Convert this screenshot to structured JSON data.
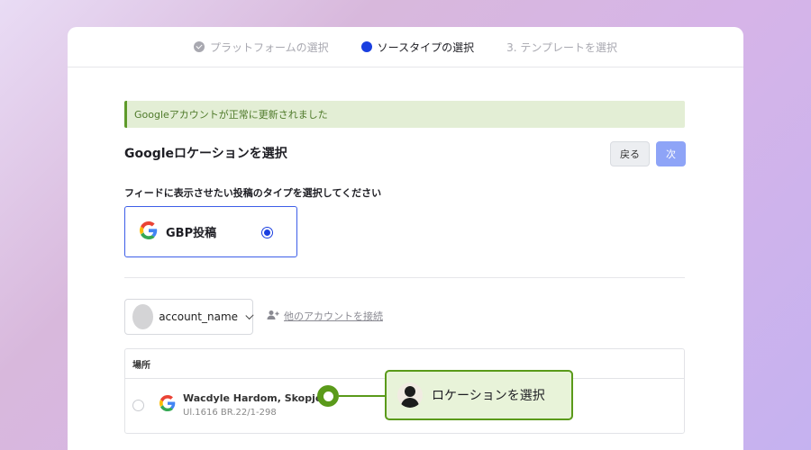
{
  "steps": [
    {
      "label": "プラットフォームの選択",
      "state": "done"
    },
    {
      "label": "ソースタイプの選択",
      "state": "current"
    },
    {
      "label": "3.  テンプレートを選択",
      "state": "pending"
    }
  ],
  "alert": {
    "text": "Googleアカウントが正常に更新されました"
  },
  "section": {
    "title": "Googleロケーションを選択"
  },
  "buttons": {
    "back": "戻る",
    "next": "次"
  },
  "feed": {
    "prompt": "フィードに表示させたい投稿のタイプを選択してください",
    "option": {
      "label": "GBP投稿",
      "selected": true
    }
  },
  "account": {
    "name": "account_name",
    "connect_label": "他のアカウントを接続"
  },
  "table": {
    "header": "場所",
    "rows": [
      {
        "name": "Wacdyle Hardom, Skopje",
        "address": "Ul.1616 BR.22/1-298",
        "selected": false
      }
    ]
  },
  "tooltip": {
    "text": "ロケーションを選択"
  },
  "colors": {
    "accent": "#1a3fe0",
    "success": "#5a9a1a",
    "alert_bg": "#e3eed5",
    "next_button": "#8ea4f7"
  }
}
